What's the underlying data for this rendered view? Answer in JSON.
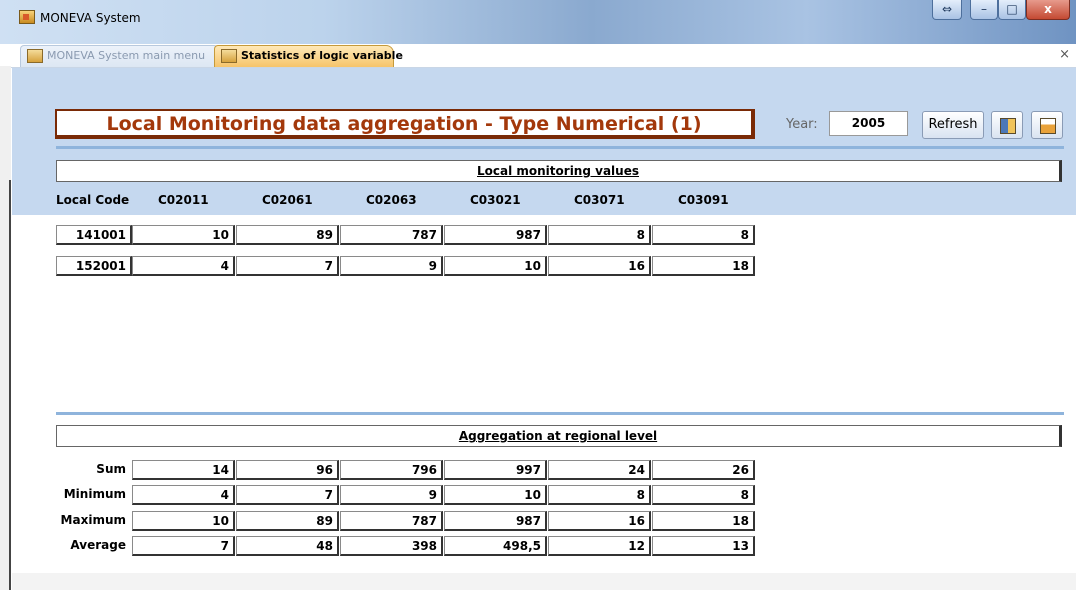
{
  "window": {
    "title": "MONEVA System",
    "controls": {
      "restore": "⇔",
      "minimize": "–",
      "maximize": "□",
      "close": "x"
    }
  },
  "tabs": [
    {
      "label": "MONEVA System main menu"
    },
    {
      "label": "Statistics of logic variable"
    }
  ],
  "tab_close": "×",
  "header": {
    "title": "Local Monitoring data aggregation - Type Numerical (1)",
    "year_label": "Year:",
    "year_value": "2005",
    "refresh_label": "Refresh"
  },
  "local_values": {
    "section_title": "Local monitoring values",
    "code_header": "Local Code",
    "columns": [
      "C02011",
      "C02061",
      "C02063",
      "C03021",
      "C03071",
      "C03091"
    ],
    "rows": [
      {
        "code": "141001",
        "values": [
          "10",
          "89",
          "787",
          "987",
          "8",
          "8"
        ]
      },
      {
        "code": "152001",
        "values": [
          "4",
          "7",
          "9",
          "10",
          "16",
          "18"
        ]
      }
    ]
  },
  "aggregation": {
    "section_title": "Aggregation at regional level",
    "rows": [
      {
        "label": "Sum",
        "values": [
          "14",
          "96",
          "796",
          "997",
          "24",
          "26"
        ]
      },
      {
        "label": "Minimum",
        "values": [
          "4",
          "7",
          "9",
          "10",
          "8",
          "8"
        ]
      },
      {
        "label": "Maximum",
        "values": [
          "10",
          "89",
          "787",
          "987",
          "16",
          "18"
        ]
      },
      {
        "label": "Average",
        "values": [
          "7",
          "48",
          "398",
          "498,5",
          "12",
          "13"
        ]
      }
    ]
  }
}
